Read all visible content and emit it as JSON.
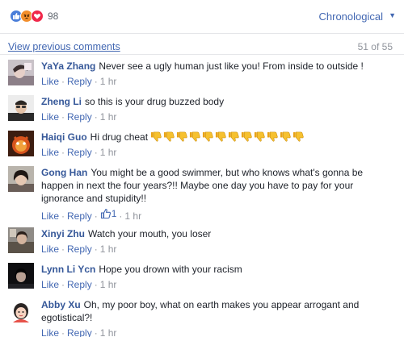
{
  "header": {
    "reaction_count": "98",
    "reaction_icons": [
      "like-icon",
      "angry-icon",
      "love-icon"
    ],
    "sort_label": "Chronological",
    "sort_caret": "▼"
  },
  "comments_bar": {
    "view_previous": "View previous comments",
    "count": "51 of 55"
  },
  "actions_text": {
    "like": "Like",
    "reply": "Reply",
    "dot": "·"
  },
  "comments": [
    {
      "name": "YaYa Zhang",
      "text": "Never see a ugly human just like you! From inside to outside !",
      "time": "1 hr"
    },
    {
      "name": "Zheng Li",
      "text": "so this is your drug buzzed body",
      "time": "1 hr"
    },
    {
      "name": "Haiqi Guo",
      "text": "Hi drug cheat",
      "emoji": "thumbs-down-icon",
      "emoji_count": 12,
      "time": "1 hr"
    },
    {
      "name": "Gong Han",
      "text": "You might be a good swimmer, but who knows what's gonna be happen in next the four years?!! Maybe one day you have to pay for your ignorance and stupidity!!",
      "likes": "1",
      "time": "1 hr"
    },
    {
      "name": "Xinyi Zhu",
      "text": "Watch your mouth, you loser",
      "time": "1 hr"
    },
    {
      "name": "Lynn Li Ycn",
      "text": "Hope you drown with your racism",
      "time": "1 hr"
    },
    {
      "name": "Abby Xu",
      "text": "Oh, my poor boy, what on earth makes you appear arrogant and egotistical?!",
      "time": "1 hr"
    }
  ],
  "colors": {
    "link": "#4267b2",
    "name": "#365899",
    "meta": "#90949c",
    "divider": "#e5e6e9"
  }
}
